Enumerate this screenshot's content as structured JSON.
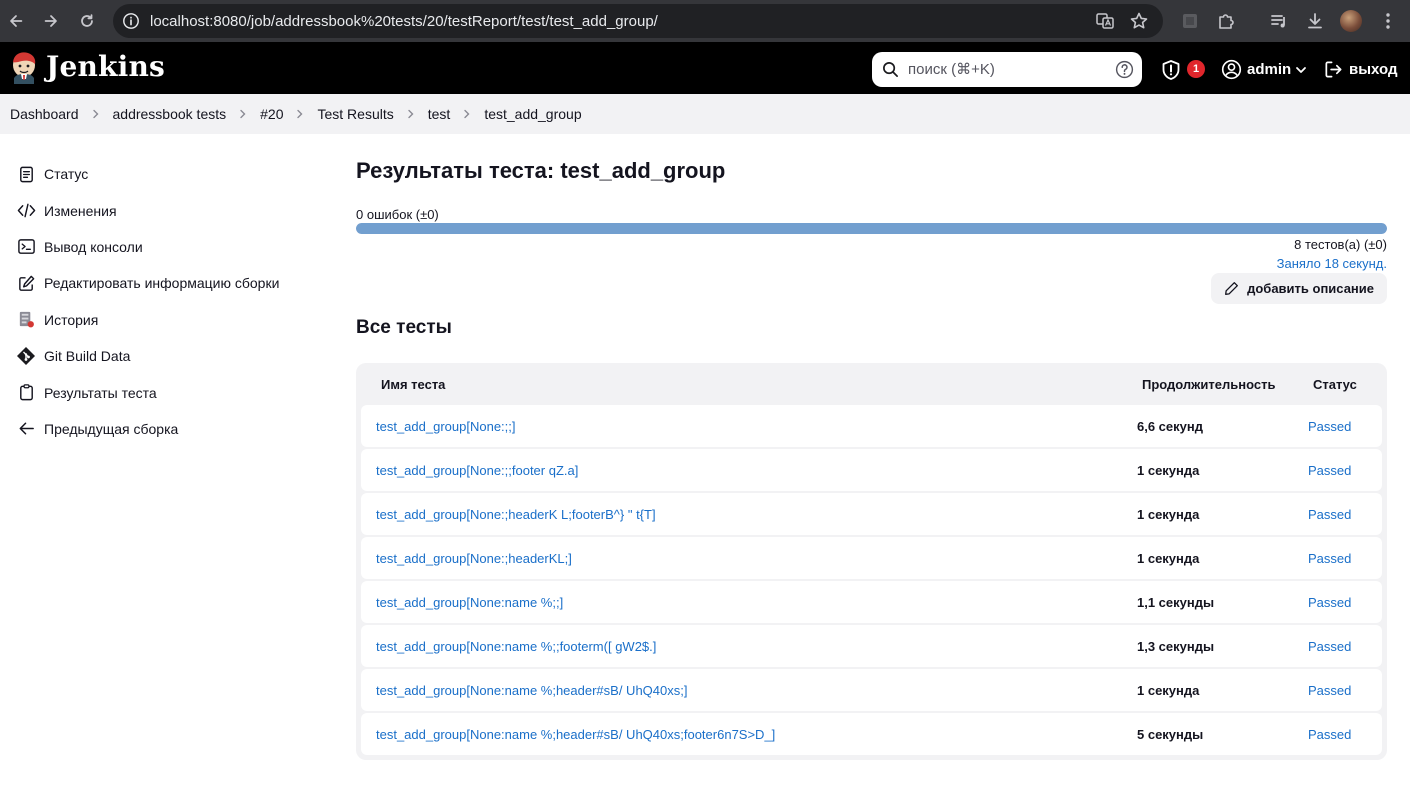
{
  "browser": {
    "url": "localhost:8080/job/addressbook%20tests/20/testReport/test/test_add_group/"
  },
  "header": {
    "brand": "Jenkins",
    "search_placeholder": "поиск (⌘+K)",
    "security_badge": "1",
    "username": "admin",
    "logout": "выход"
  },
  "breadcrumb": [
    {
      "label": "Dashboard"
    },
    {
      "label": "addressbook tests"
    },
    {
      "label": "#20"
    },
    {
      "label": "Test Results"
    },
    {
      "label": "test"
    },
    {
      "label": "test_add_group"
    }
  ],
  "sidebar": {
    "items": [
      {
        "label": "Статус",
        "icon": "status-icon"
      },
      {
        "label": "Изменения",
        "icon": "code-icon"
      },
      {
        "label": "Вывод консоли",
        "icon": "terminal-icon"
      },
      {
        "label": "Редактировать информацию сборки",
        "icon": "edit-icon"
      },
      {
        "label": "История",
        "icon": "history-icon"
      },
      {
        "label": "Git Build Data",
        "icon": "git-icon"
      },
      {
        "label": "Результаты теста",
        "icon": "clipboard-icon"
      },
      {
        "label": "Предыдущая сборка",
        "icon": "arrow-left-icon"
      }
    ]
  },
  "main": {
    "title": "Результаты теста: test_add_group",
    "fail_count": "0 ошибок (±0)",
    "pass_fraction": 1.0,
    "test_count": "8 тестов(а) (±0)",
    "took": "Заняло 18 секунд.",
    "add_description": "добавить описание",
    "all_tests_heading": "Все тесты",
    "columns": [
      "Имя теста",
      "Продолжительность",
      "Статус"
    ],
    "rows": [
      {
        "name": "test_add_group[None:;;]",
        "duration": "6,6 секунд",
        "status": "Passed"
      },
      {
        "name": "test_add_group[None:;;footer qZ.a]",
        "duration": "1 секунда",
        "status": "Passed"
      },
      {
        "name": "test_add_group[None:;headerK L;footerB^} \" t{T]",
        "duration": "1 секунда",
        "status": "Passed"
      },
      {
        "name": "test_add_group[None:;headerKL;]",
        "duration": "1 секунда",
        "status": "Passed"
      },
      {
        "name": "test_add_group[None:name %;;]",
        "duration": "1,1 секунды",
        "status": "Passed"
      },
      {
        "name": "test_add_group[None:name %;;footerm([ gW2$.]",
        "duration": "1,3 секунды",
        "status": "Passed"
      },
      {
        "name": "test_add_group[None:name %;header#sB/ UhQ40xs;]",
        "duration": "1 секунда",
        "status": "Passed"
      },
      {
        "name": "test_add_group[None:name %;header#sB/ UhQ40xs;footer6n7S>D_]",
        "duration": "5 секунды",
        "status": "Passed"
      }
    ]
  },
  "colors": {
    "link": "#1a6fc9",
    "progress_pass": "#729fcf",
    "badge": "#e0262c",
    "header_bg": "#000000"
  }
}
